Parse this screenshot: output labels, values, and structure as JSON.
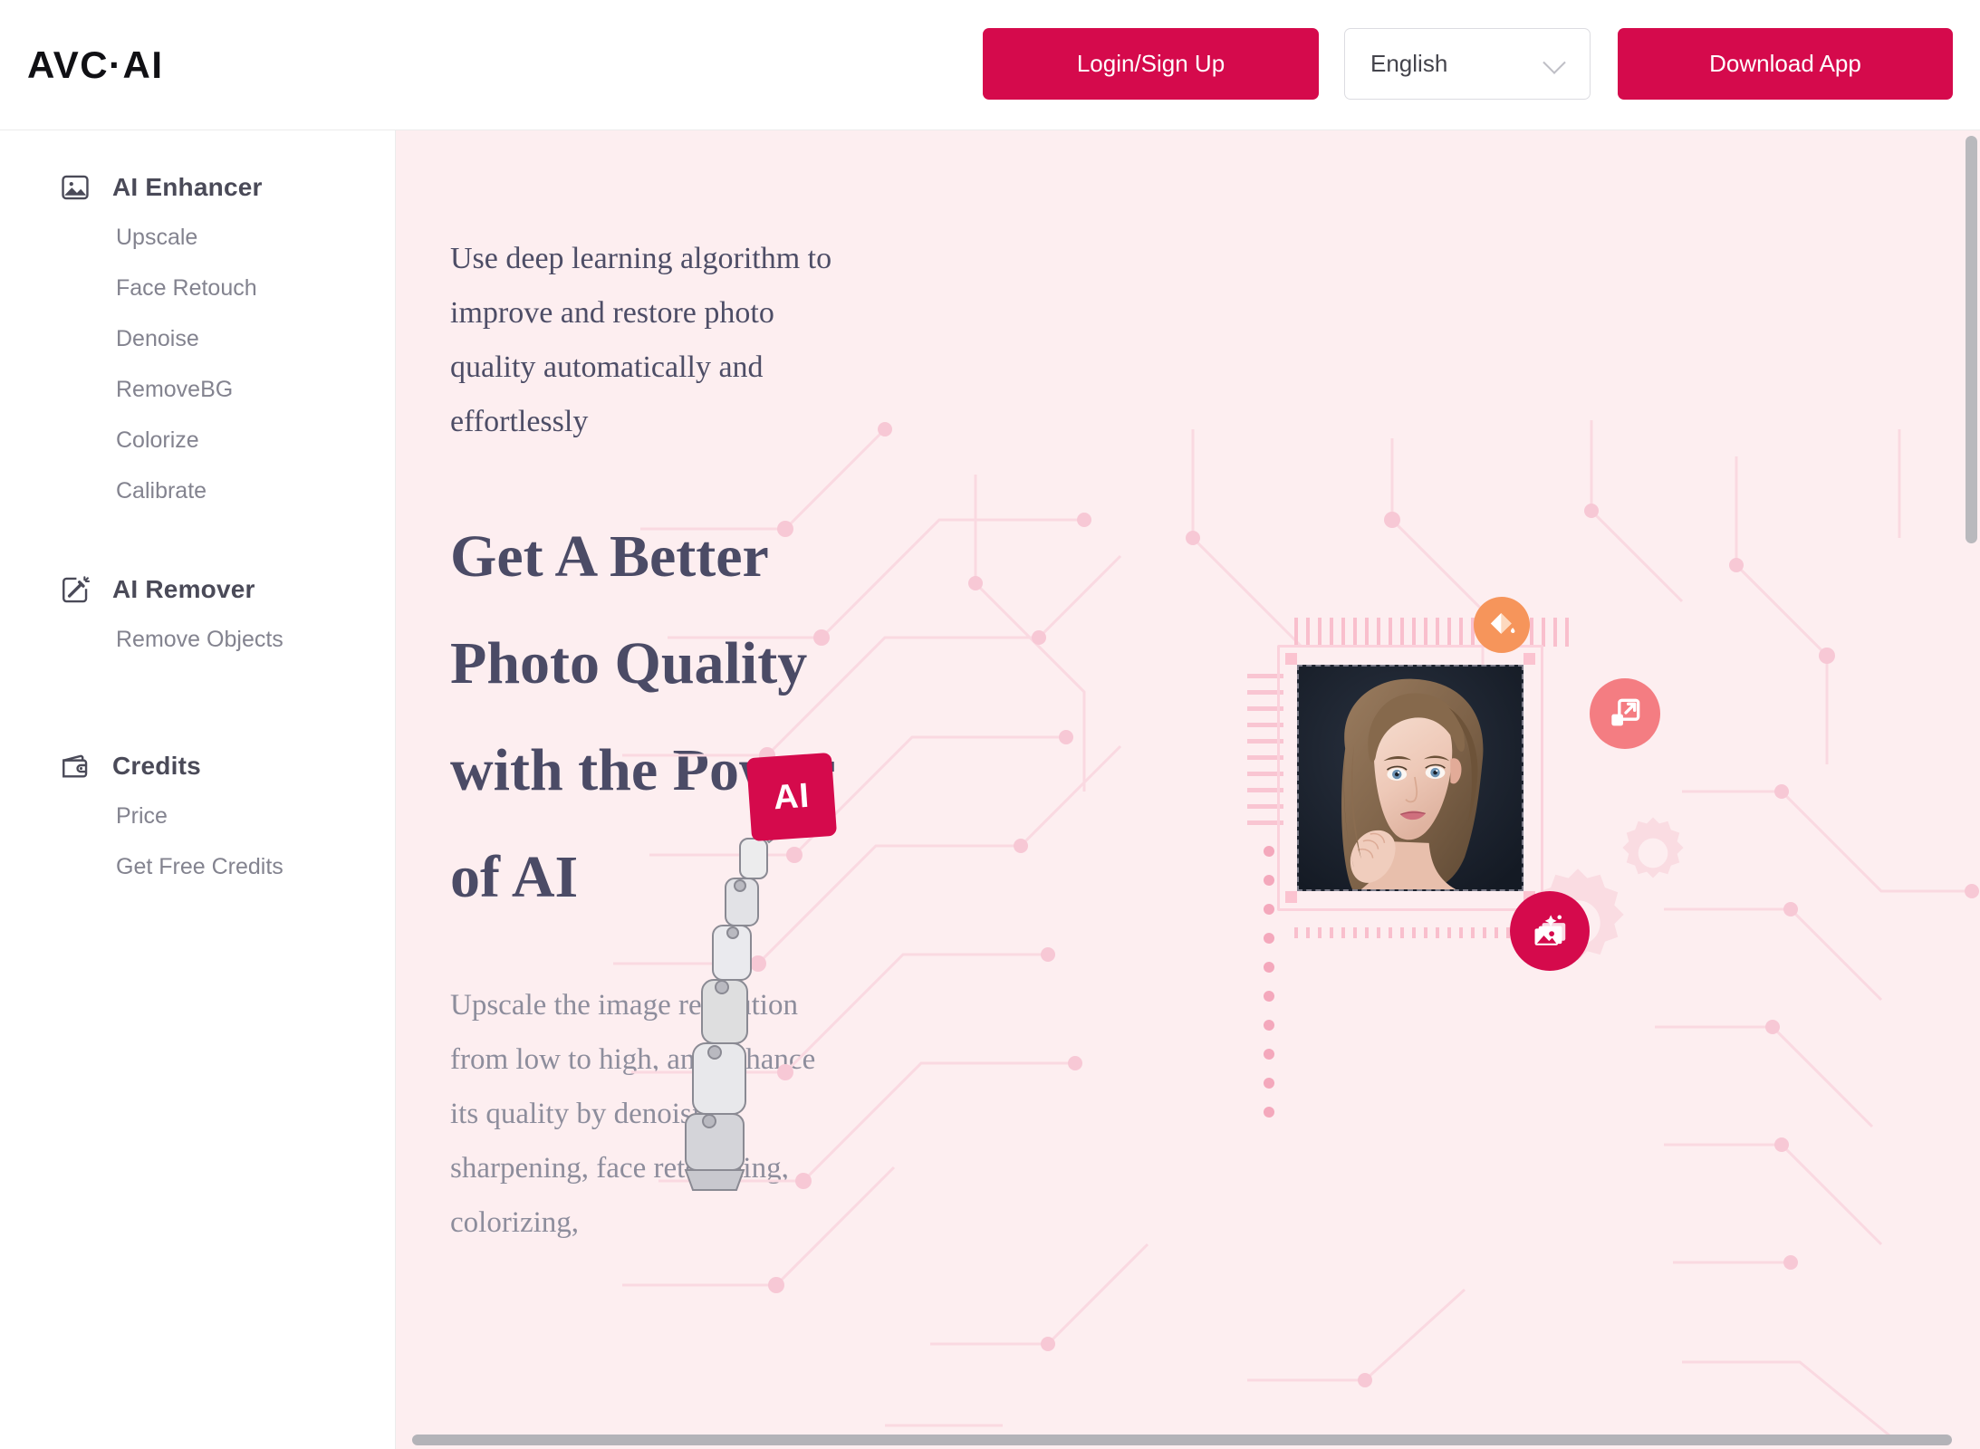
{
  "header": {
    "logo": "AVC·AI",
    "login_label": "Login/Sign Up",
    "language_value": "English",
    "download_label": "Download App"
  },
  "sidebar": {
    "groups": [
      {
        "label": "AI Enhancer",
        "icon": "image-icon",
        "items": [
          "Upscale",
          "Face Retouch",
          "Denoise",
          "RemoveBG",
          "Colorize",
          "Calibrate"
        ]
      },
      {
        "label": "AI Remover",
        "icon": "magic-wand-icon",
        "items": [
          "Remove Objects"
        ]
      },
      {
        "label": "Credits",
        "icon": "wallet-icon",
        "items": [
          "Price",
          "Get Free Credits"
        ]
      }
    ]
  },
  "main": {
    "kicker": "Use deep learning algorithm to improve and restore photo quality automatically and effortlessly",
    "heading": "Get A Better Photo Quality with the Power of AI",
    "subcopy": "Upscale the image resolution from low to high, and enhance its quality by denoising, sharpening, face retouching, colorizing,",
    "ai_tile_label": "AI",
    "badges": [
      {
        "name": "paint-bucket-icon",
        "color": "#F6955B"
      },
      {
        "name": "resize-expand-icon",
        "color": "#F47D82"
      },
      {
        "name": "image-enhance-icon",
        "color": "#D50A4C"
      }
    ]
  },
  "theme": {
    "accent": "#D50A4C",
    "content_bg": "#FDEEF0",
    "sidebar_bg": "#FFFFFF",
    "heading_color": "#4B4B66",
    "muted_text": "#8D8D9C",
    "sidebar_item_color": "#83838F"
  }
}
